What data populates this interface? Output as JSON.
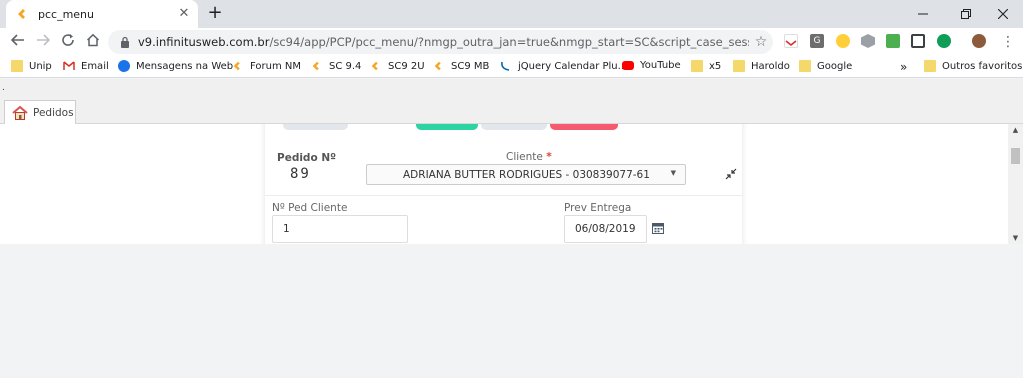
{
  "browser": {
    "tab_title": "pcc_menu",
    "tab_close": "✕",
    "new_tab": "+",
    "url_host": "v9.infinitusweb.com.br",
    "url_path": "/sc94/app/PCP/pcc_menu/?nmgp_outra_jan=true&nmgp_start=SC&script_case_session=kqlcb93...",
    "bookmarks": [
      {
        "label": "Unip",
        "icon": "folder-icon"
      },
      {
        "label": "Email",
        "icon": "gmail-icon"
      },
      {
        "label": "Mensagens na Web",
        "icon": "messages-icon"
      },
      {
        "label": "Forum NM",
        "icon": "scriptcase-icon"
      },
      {
        "label": "SC 9.4",
        "icon": "scriptcase-icon"
      },
      {
        "label": "SC9 2U",
        "icon": "scriptcase-icon"
      },
      {
        "label": "SC9 MB",
        "icon": "scriptcase-icon"
      },
      {
        "label": "jQuery Calendar Plu...",
        "icon": "jquery-icon"
      },
      {
        "label": "YouTube",
        "icon": "youtube-icon"
      },
      {
        "label": "x5",
        "icon": "folder-icon"
      },
      {
        "label": "Haroldo",
        "icon": "folder-icon"
      },
      {
        "label": "Google",
        "icon": "folder-icon"
      }
    ],
    "bookmarks_overflow": "»",
    "other_bookmarks": "Outros favoritos"
  },
  "app": {
    "dot": ".",
    "tab_label": "Pedidos"
  },
  "form": {
    "pedido_label": "Pedido Nº",
    "pedido_value": "89",
    "cliente_label": "Cliente",
    "cliente_required": "*",
    "cliente_value": "ADRIANA BUTTER RODRIGUES - 030839077-61",
    "nped_label": "Nº Ped Cliente",
    "nped_value": "1",
    "prev_label": "Prev Entrega",
    "prev_value": "06/08/2019"
  },
  "colors": {
    "btn_green": "#2dd3a0",
    "btn_gray": "#e3e7ec",
    "btn_red": "#f65a6e",
    "folder": "#f4d86b"
  }
}
